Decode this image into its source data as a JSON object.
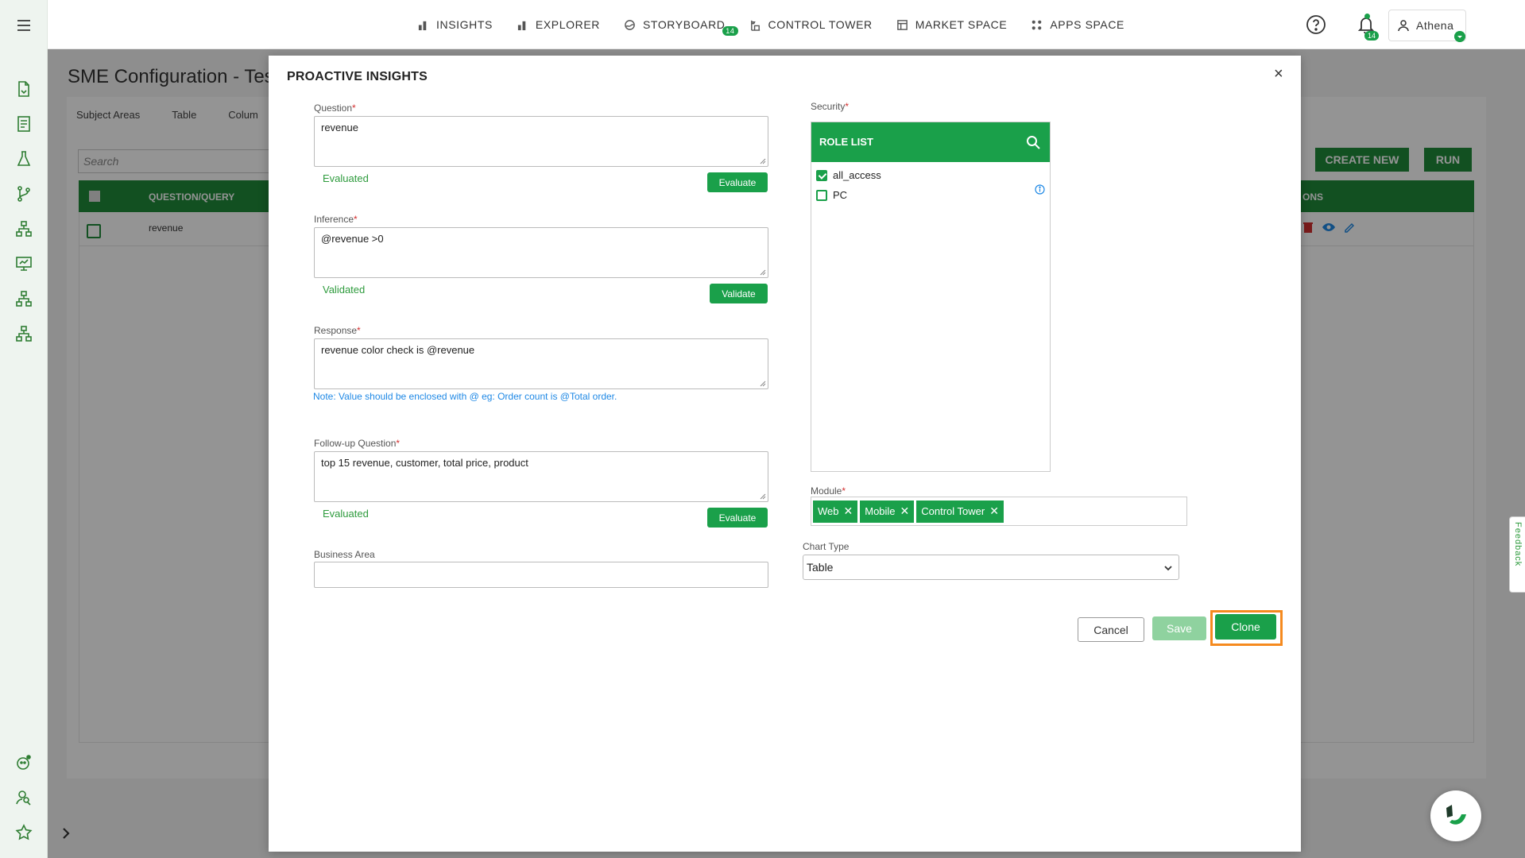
{
  "nav": {
    "items": [
      {
        "label": "INSIGHTS",
        "icon": "bar-chart-icon"
      },
      {
        "label": "EXPLORER",
        "icon": "bar-chart-icon"
      },
      {
        "label": "STORYBOARD",
        "icon": "storyboard-icon",
        "badge": "14"
      },
      {
        "label": "CONTROL TOWER",
        "icon": "tower-icon"
      },
      {
        "label": "MARKET SPACE",
        "icon": "market-icon"
      },
      {
        "label": "APPS SPACE",
        "icon": "apps-grid-icon"
      }
    ],
    "notifications_badge": "14",
    "user_name": "Athena"
  },
  "background": {
    "title": "SME Configuration - Tes",
    "tabs": [
      "Subject Areas",
      "Table",
      "Colum"
    ],
    "search_placeholder": "Search",
    "table_header": "QUESTION/QUERY",
    "table_header_right": "ONS",
    "row_text": "revenue",
    "create_new": "CREATE NEW",
    "run": "RUN"
  },
  "modal": {
    "title": "PROACTIVE INSIGHTS",
    "close": "×",
    "question": {
      "label": "Question",
      "value": "revenue",
      "status": "Evaluated",
      "button": "Evaluate"
    },
    "inference": {
      "label": "Inference",
      "value": "@revenue >0",
      "status": "Validated",
      "button": "Validate"
    },
    "response": {
      "label": "Response",
      "value": "revenue color check is @revenue"
    },
    "note": "Note: Value should be enclosed with @ eg: Order count is @Total order.",
    "followup": {
      "label": "Follow-up Question",
      "value": "top 15 revenue, customer, total price, product",
      "status": "Evaluated",
      "button": "Evaluate"
    },
    "business_area": {
      "label": "Business Area",
      "value": ""
    },
    "security": {
      "label": "Security",
      "role_list_title": "ROLE LIST",
      "roles": [
        {
          "name": "all_access",
          "checked": true
        },
        {
          "name": "PC",
          "checked": false
        }
      ]
    },
    "module": {
      "label": "Module",
      "chips": [
        "Web",
        "Mobile",
        "Control Tower"
      ]
    },
    "chart_type": {
      "label": "Chart Type",
      "value": "Table"
    },
    "buttons": {
      "cancel": "Cancel",
      "save": "Save",
      "clone": "Clone"
    }
  },
  "feedback": "Feedback",
  "colors": {
    "primary_green": "#1aa04a",
    "highlight_orange": "#f58a1f",
    "note_blue": "#1e88e5"
  }
}
